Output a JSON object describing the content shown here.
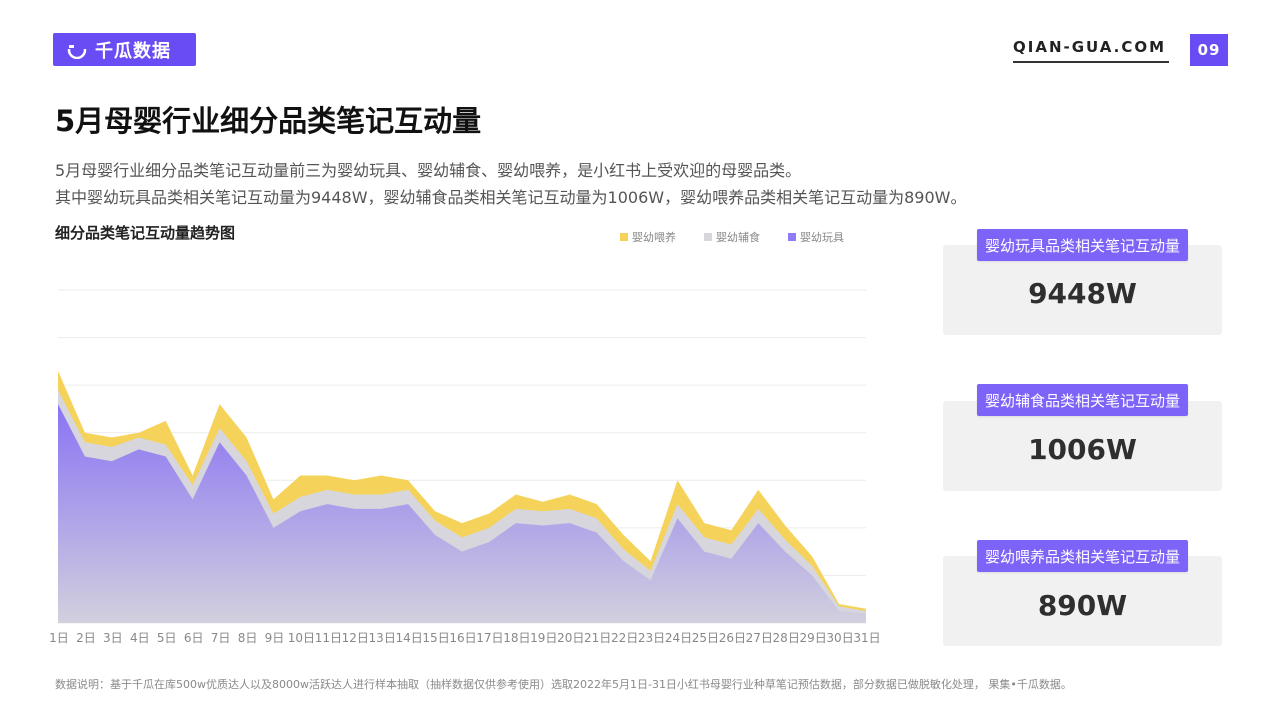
{
  "brand": {
    "name": "千瓜数据",
    "site": "QIAN-GUA.COM",
    "page_number": "09",
    "accent": "#6a4cf5"
  },
  "title": "5月母婴行业细分品类笔记互动量",
  "description": {
    "line1": "5月母婴行业细分品类笔记互动量前三为婴幼玩具、婴幼辅食、婴幼喂养，是小红书上受欢迎的母婴品类。",
    "line2": "其中婴幼玩具品类相关笔记互动量为9448W，婴幼辅食品类相关笔记互动量为1006W，婴幼喂养品类相关笔记互动量为890W。"
  },
  "chart_data": {
    "type": "area",
    "stacked": true,
    "title": "细分品类笔记互动量趋势图",
    "x": [
      "1日",
      "2日",
      "3日",
      "4日",
      "5日",
      "6日",
      "7日",
      "8日",
      "9日",
      "10日",
      "11日",
      "12日",
      "13日",
      "14日",
      "15日",
      "16日",
      "17日",
      "18日",
      "19日",
      "20日",
      "21日",
      "22日",
      "23日",
      "24日",
      "25日",
      "26日",
      "27日",
      "28日",
      "29日",
      "30日",
      "31日"
    ],
    "ylim": [
      0,
      7
    ],
    "grid": true,
    "legend_position": "top-right",
    "series": [
      {
        "name": "婴幼玩具",
        "color": "#8f7bf5",
        "values": [
          4.6,
          3.5,
          3.4,
          3.65,
          3.5,
          2.6,
          3.8,
          3.1,
          2.0,
          2.35,
          2.5,
          2.4,
          2.4,
          2.5,
          1.85,
          1.5,
          1.7,
          2.1,
          2.05,
          2.1,
          1.9,
          1.3,
          0.9,
          2.2,
          1.5,
          1.35,
          2.1,
          1.5,
          1.0,
          0.25,
          0.2
        ]
      },
      {
        "name": "婴幼辅食",
        "color": "#d6d6dc",
        "values": [
          0.3,
          0.3,
          0.3,
          0.25,
          0.25,
          0.3,
          0.3,
          0.3,
          0.3,
          0.3,
          0.3,
          0.3,
          0.3,
          0.3,
          0.3,
          0.3,
          0.3,
          0.3,
          0.3,
          0.3,
          0.3,
          0.25,
          0.2,
          0.3,
          0.3,
          0.3,
          0.3,
          0.25,
          0.2,
          0.1,
          0.05
        ]
      },
      {
        "name": "婴幼喂养",
        "color": "#f5d35a",
        "values": [
          0.4,
          0.2,
          0.2,
          0.1,
          0.5,
          0.2,
          0.5,
          0.5,
          0.3,
          0.45,
          0.3,
          0.3,
          0.4,
          0.2,
          0.2,
          0.3,
          0.3,
          0.3,
          0.2,
          0.3,
          0.3,
          0.3,
          0.2,
          0.5,
          0.3,
          0.3,
          0.4,
          0.3,
          0.2,
          0.05,
          0.05
        ]
      }
    ]
  },
  "cards": [
    {
      "label": "婴幼玩具品类相关笔记互动量",
      "value": "9448W"
    },
    {
      "label": "婴幼辅食品类相关笔记互动量",
      "value": "1006W"
    },
    {
      "label": "婴幼喂养品类相关笔记互动量",
      "value": "890W"
    }
  ],
  "footnote": "数据说明：基于千瓜在库500w优质达人以及8000w活跃达人进行样本抽取（抽样数据仅供参考使用）选取2022年5月1日-31日小红书母婴行业种草笔记预估数据，部分数据已做脱敏化处理， 果集•千瓜数据。"
}
